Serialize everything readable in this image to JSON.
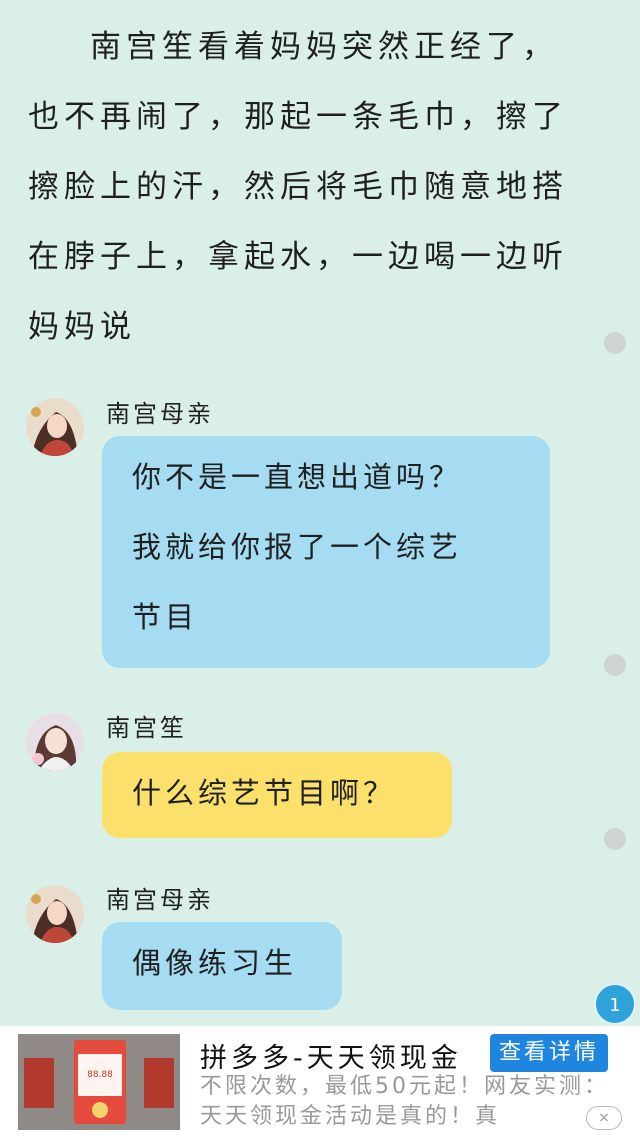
{
  "narration": "南宫笙看着妈妈突然正经了，也不再闹了，那起一条毛巾，擦了擦脸上的汗，然后将毛巾随意地搭在脖子上，拿起水，一边喝一边听妈妈说",
  "messages": [
    {
      "speaker": "南宫母亲",
      "lines": [
        "你不是一直想出道吗？",
        "我就给你报了一个综艺",
        "节目"
      ],
      "color": "blue"
    },
    {
      "speaker": "南宫笙",
      "lines": [
        "什么综艺节目啊？"
      ],
      "color": "yellow"
    },
    {
      "speaker": "南宫母亲",
      "lines": [
        "偶像练习生"
      ],
      "color": "blue"
    }
  ],
  "page_badge": "1",
  "ad": {
    "title": "拼多多-天天领现金",
    "button": "查看详情",
    "description": "不限次数，最低50元起！网友实测：天天领现金活动是真的！真",
    "thumb_amount": "88.88",
    "close": "×"
  },
  "colors": {
    "background": "#d9efe8",
    "bubble_blue": "#a5dcf2",
    "bubble_yellow": "#fbe06c",
    "ad_button": "#1f86e0"
  }
}
